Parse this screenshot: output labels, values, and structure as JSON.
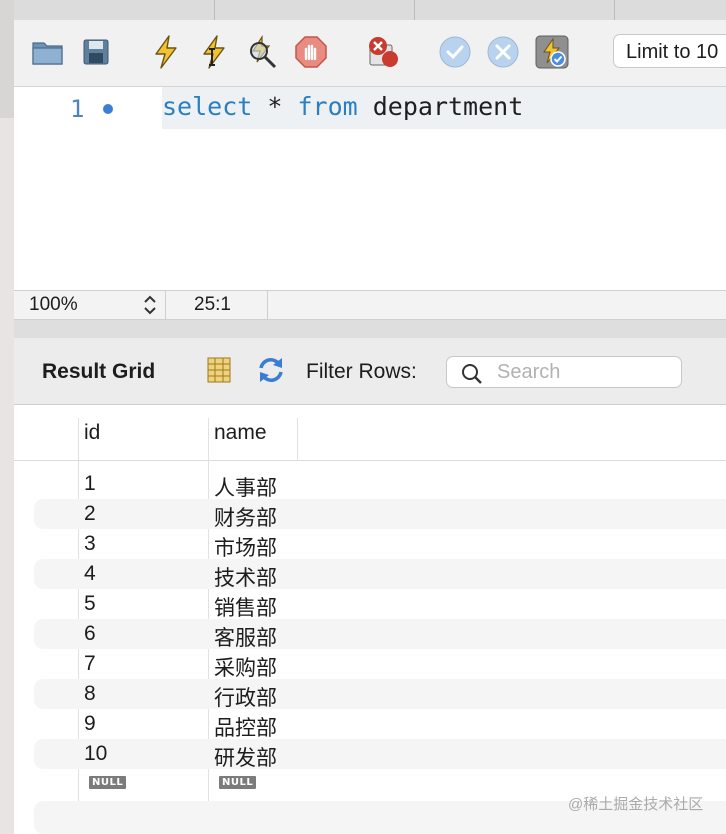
{
  "toolbar": {
    "icons": [
      "open-file-icon",
      "save-icon",
      "execute-icon",
      "execute-current-icon",
      "explain-icon",
      "stop-icon",
      "toggle-error-icon",
      "commit-icon",
      "rollback-icon",
      "autocommit-icon"
    ],
    "limit_label": "Limit to 10"
  },
  "editor": {
    "line_number": "1",
    "code": {
      "kw1": "select",
      "star": " * ",
      "kw2": "from",
      "rest": " department"
    }
  },
  "status": {
    "zoom": "100%",
    "cursor": "25:1"
  },
  "result": {
    "title": "Result Grid",
    "filter_label": "Filter Rows:",
    "search_placeholder": "Search",
    "columns": [
      "id",
      "name"
    ],
    "rows": [
      {
        "id": "1",
        "name": "人事部"
      },
      {
        "id": "2",
        "name": "财务部"
      },
      {
        "id": "3",
        "name": "市场部"
      },
      {
        "id": "4",
        "name": "技术部"
      },
      {
        "id": "5",
        "name": "销售部"
      },
      {
        "id": "6",
        "name": "客服部"
      },
      {
        "id": "7",
        "name": "采购部"
      },
      {
        "id": "8",
        "name": "行政部"
      },
      {
        "id": "9",
        "name": "品控部"
      },
      {
        "id": "10",
        "name": "研发部"
      }
    ],
    "null_label": "NULL"
  },
  "watermark": "@稀土掘金技术社区",
  "colors": {
    "keyword": "#2a7fc3",
    "gutter": "#4d86b7",
    "accent": "#3d7ed6"
  }
}
